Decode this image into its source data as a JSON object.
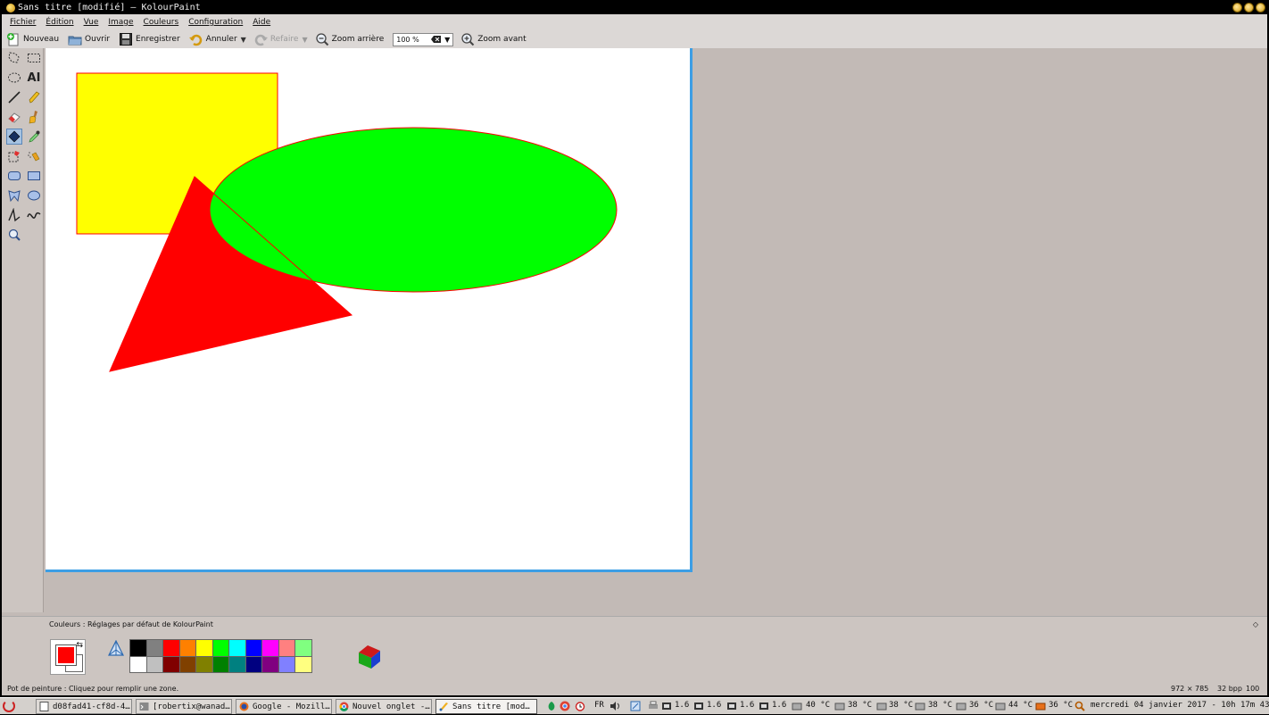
{
  "window": {
    "title": "Sans titre [modifié] – KolourPaint"
  },
  "menu": [
    "Fichier",
    "Édition",
    "Vue",
    "Image",
    "Couleurs",
    "Configuration",
    "Aide"
  ],
  "toolbar": {
    "new_label": "Nouveau",
    "open_label": "Ouvrir",
    "save_label": "Enregistrer",
    "undo_label": "Annuler",
    "redo_label": "Refaire",
    "zoom_out_label": "Zoom arrière",
    "zoom_value": "100 %",
    "zoom_in_label": "Zoom avant"
  },
  "tools": [
    "free-select-icon",
    "rect-select-icon",
    "ellipse-select-icon",
    "text-icon",
    "line-icon",
    "pencil-icon",
    "eraser-icon",
    "brush-icon",
    "flood-fill-icon",
    "color-picker-icon",
    "color-eraser-icon",
    "spraycan-icon",
    "rounded-rect-icon",
    "rectangle-icon",
    "polygon-icon",
    "ellipse-icon",
    "polyline-icon",
    "curve-icon",
    "zoom-icon"
  ],
  "tools_text_label": "AI",
  "colors": {
    "title": "Couleurs : Réglages par défaut de KolourPaint",
    "foreground": "#ff0000",
    "background": "#ffffff",
    "palette_top": [
      "#000000",
      "#808080",
      "#ff0000",
      "#ff8000",
      "#ffff00",
      "#00ff00",
      "#00ffff",
      "#0000ff",
      "#ff00ff",
      "#ff8080",
      "#80ff80"
    ],
    "palette_bottom": [
      "#ffffff",
      "#c0c0c0",
      "#800000",
      "#804000",
      "#808000",
      "#008000",
      "#008080",
      "#000080",
      "#800080",
      "#8080ff",
      "#ffff80"
    ]
  },
  "canvas_shapes": {
    "rect_fill": "#ffff00",
    "ellipse_fill": "#00ff00",
    "triangle_fill": "#ff0000",
    "outline": "#ff0000"
  },
  "status": {
    "tool_hint": "Pot de peinture : Cliquez pour remplir une zone.",
    "dimensions": "972 × 785",
    "bpp": "32 bpp",
    "zoom": "100 %"
  },
  "taskbar": {
    "tasks": [
      "d08fad41-cf8d-4…",
      "[robertix@wanad…",
      "Google - Mozill…",
      "Nouvel onglet -…",
      "Sans titre [mod…"
    ],
    "lang": "FR",
    "cpu": [
      "1.6",
      "1.6",
      "1.6",
      "1.6"
    ],
    "temps": [
      "40 °C",
      "38 °C",
      "38 °C",
      "38 °C",
      "36 °C",
      "44 °C",
      "36 °C"
    ],
    "clock": "mercredi 04 janvier 2017 - 10h 17m 43s"
  }
}
